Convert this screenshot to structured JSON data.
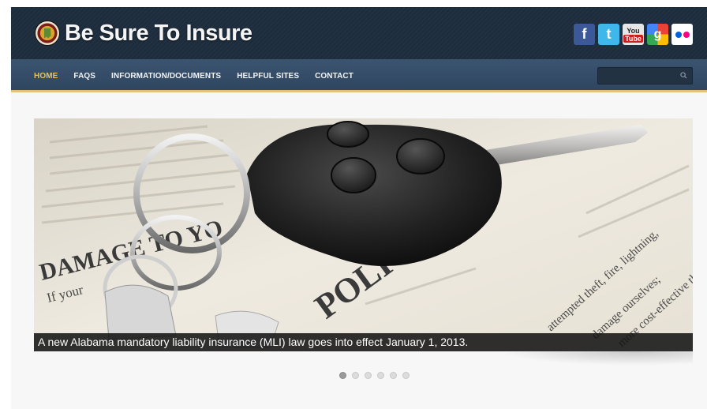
{
  "header": {
    "site_title": "Be Sure To Insure",
    "social": [
      {
        "name": "facebook",
        "glyph": "f",
        "color": "#3b5998"
      },
      {
        "name": "twitter",
        "glyph": "t",
        "color": "#3fb7ea"
      },
      {
        "name": "youtube",
        "you": "You",
        "tube": "Tube"
      },
      {
        "name": "google",
        "glyph": "g"
      },
      {
        "name": "flickr",
        "colors": [
          "#0063dc",
          "#ff0084"
        ]
      }
    ]
  },
  "nav": {
    "items": [
      {
        "label": "HOME",
        "active": true
      },
      {
        "label": "FAQS"
      },
      {
        "label": "INFORMATION/DOCUMENTS"
      },
      {
        "label": "HELPFUL SITES"
      },
      {
        "label": "CONTACT"
      }
    ],
    "search": {
      "value": "",
      "placeholder": ""
    }
  },
  "slider": {
    "caption": "A new Alabama mandatory liability insurance (MLI) law goes into effect January 1, 2013.",
    "image_text": {
      "damage": "DAMAGE TO YO",
      "if_your": "If your",
      "policy": "POLICY",
      "attempted": "attempted theft, fire, lightning,",
      "damage_ourselves": "damage ourselves;",
      "cost_effective": "more cost-effective than"
    },
    "total_slides": 6,
    "active_slide": 1
  }
}
